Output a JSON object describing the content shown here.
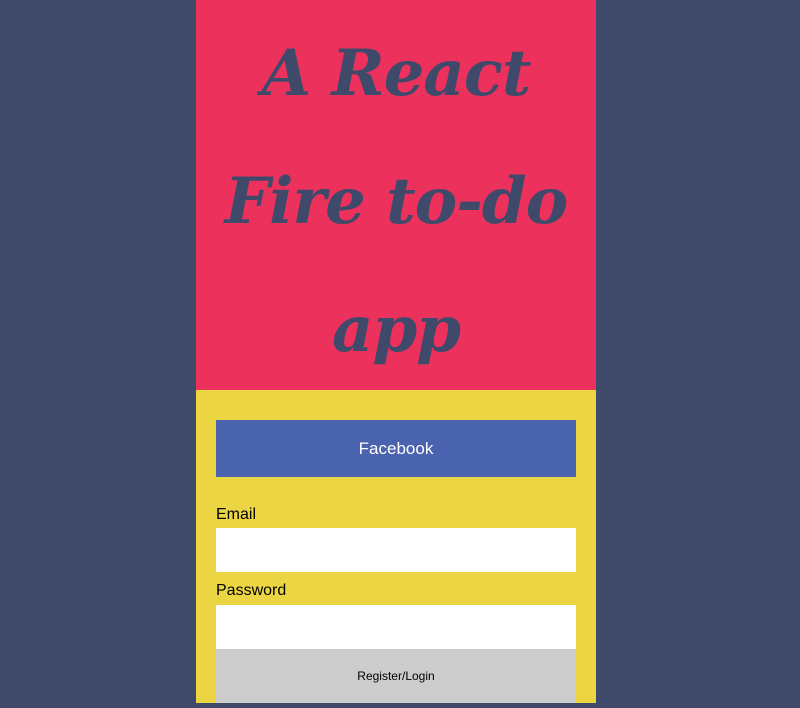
{
  "header": {
    "title_lines": [
      "A React",
      "Fire to-do",
      "app"
    ]
  },
  "auth": {
    "facebook_label": "Facebook",
    "email_label": "Email",
    "email_value": "",
    "password_label": "Password",
    "password_value": "",
    "submit_label": "Register/Login"
  },
  "colors": {
    "page_background": "#3f4a6b",
    "hero_background": "#ec315d",
    "panel_background": "#ecd542",
    "facebook_button": "#4a63ae",
    "submit_button": "#cccccc"
  }
}
